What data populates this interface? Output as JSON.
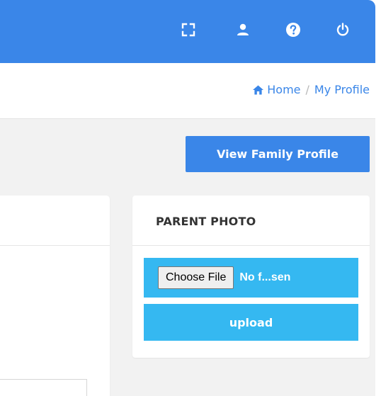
{
  "topbar": {
    "bg_color": "#3a86e8",
    "icons": [
      "fullscreen-icon",
      "user-icon",
      "help-icon",
      "power-icon"
    ]
  },
  "breadcrumb": {
    "home_label": "Home",
    "separator": "/",
    "current_label": "My Profile"
  },
  "actions": {
    "view_family_profile_label": "View Family Profile"
  },
  "parent_photo": {
    "title": "PARENT PHOTO",
    "choose_file_label": "Choose File",
    "file_status": "No f...sen",
    "upload_label": "upload",
    "accent_color": "#35b8f1"
  }
}
